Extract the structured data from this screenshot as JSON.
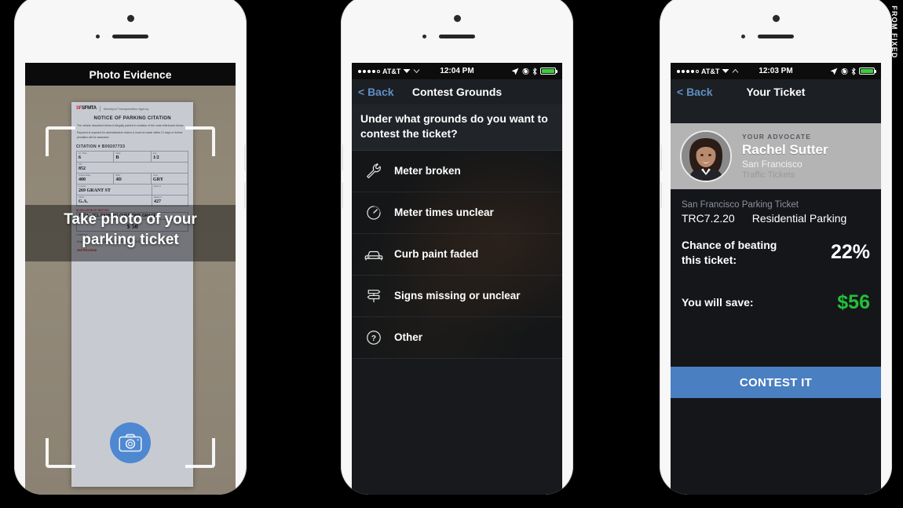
{
  "watermark": {
    "text": "FROM FIXED"
  },
  "phone1": {
    "header_title": "Photo Evidence",
    "overlay_line1": "Take photo of your",
    "overlay_line2": "parking ticket",
    "camera_button": "camera-icon",
    "ticket": {
      "logo": "SFMTA",
      "logo_prefix": "SF",
      "agency": "Municipal Transportation Agency",
      "title": "NOTICE OF PARKING CITATION",
      "paragraph1": "The vehicle described below is illegally parked in violation of the code referenced below.",
      "paragraph2": "Payment is required for administrative review & must be made within 21 days or further penalties will be assessed.",
      "citation_label": "CITATION #",
      "citation_number": "B09207733",
      "fields": [
        {
          "label": "Lic. Plate",
          "value": "6"
        },
        {
          "label": "State",
          "value": "B"
        },
        {
          "label": "Exp.",
          "value": "1/2"
        },
        {
          "label": "VIN",
          "value": "852"
        },
        {
          "label": "Vehicle Make",
          "value": "400"
        },
        {
          "label": "Body",
          "value": "4D"
        },
        {
          "label": "Color",
          "value": "GRY"
        },
        {
          "label": "Location",
          "value": "269 GRANT ST"
        },
        {
          "label": "Meter #",
          "value": ""
        },
        {
          "label": "Officer",
          "value": "G.A."
        },
        {
          "label": "Badge #",
          "value": "427"
        }
      ],
      "violation_label": "IN VIOLATION OF SECTION",
      "violation_value": "TC7A - 7CL PARKING OVER TIME GRACE",
      "amount_label": "AMOUNT DUE",
      "amount_value": "$ 50",
      "comments_label": "COMMENTS",
      "comments": "Fine amount includes state surcharges. NO BLOCKS. WHEELS WRONG WAY.",
      "footer_red": "SEE REVERSE"
    }
  },
  "phone2": {
    "status": {
      "carrier": "AT&T",
      "time": "12:04 PM",
      "battery": "full"
    },
    "back_label": "< Back",
    "title": "Contest Grounds",
    "question": "Under what grounds do you want to contest the ticket?",
    "grounds": [
      {
        "label": "Meter broken",
        "icon": "wrench-icon"
      },
      {
        "label": "Meter times unclear",
        "icon": "timer-icon"
      },
      {
        "label": "Curb paint faded",
        "icon": "car-icon"
      },
      {
        "label": "Signs missing or unclear",
        "icon": "street-sign-icon"
      },
      {
        "label": "Other",
        "icon": "question-mark-icon"
      }
    ]
  },
  "phone3": {
    "status": {
      "carrier": "AT&T",
      "time": "12:03 PM",
      "battery": "full"
    },
    "back_label": "< Back",
    "title": "Your Ticket",
    "advocate": {
      "kicker": "YOUR ADVOCATE",
      "name": "Rachel Sutter",
      "city": "San Francisco",
      "specialty": "Traffic Tickets"
    },
    "ticket": {
      "kicker": "San Francisco Parking Ticket",
      "code": "TRC7.2.20",
      "type": "Residential Parking"
    },
    "stats": [
      {
        "label": "Chance of beating this ticket:",
        "value": "22%",
        "money": false
      },
      {
        "label": "You will save:",
        "value": "$56",
        "money": true
      }
    ],
    "contest_button": "CONTEST IT"
  },
  "colors": {
    "accent_blue": "#4a7fc1",
    "money_green": "#22c03a",
    "battery_green": "#35d13a",
    "back_link": "#5f8fc4"
  }
}
